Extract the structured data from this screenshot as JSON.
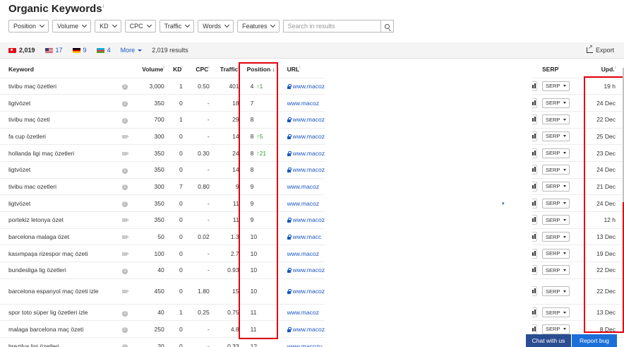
{
  "page": {
    "title": "Organic Keywords",
    "title_info": "i"
  },
  "filters": {
    "position": "Position",
    "volume": "Volume",
    "kd": "KD",
    "cpc": "CPC",
    "traffic": "Traffic",
    "words": "Words",
    "features": "Features",
    "search_placeholder": "Search in results"
  },
  "countries": {
    "tr_count": "2,019",
    "us_count": "17",
    "de_count": "9",
    "az_count": "4",
    "more": "More",
    "results": "2,019 results",
    "export": "Export"
  },
  "table": {
    "headers": {
      "keyword": "Keyword",
      "volume": "Volume",
      "kd": "KD",
      "cpc": "CPC",
      "traffic": "Traffic",
      "position": "Position",
      "position_sort": "↓",
      "url": "URL",
      "serp": "SERP",
      "upd": "Upd.",
      "info": "i"
    },
    "rows": [
      {
        "keyword": "tivibu maç özetleri",
        "icon": "question-icon",
        "icon_text": "2",
        "volume": "3,000",
        "kd": "1",
        "cpc": "0.50",
        "traffic": "401",
        "position": "4",
        "change": "↑1",
        "secure": true,
        "url": "www.macoz",
        "serp": "SERP",
        "upd": "19 h"
      },
      {
        "keyword": "ligtvözet",
        "icon": "question-icon",
        "icon_text": "2",
        "volume": "350",
        "kd": "0",
        "cpc": "-",
        "traffic": "18",
        "position": "7",
        "change": "",
        "secure": false,
        "url": "www.macoz",
        "serp": "SERP",
        "upd": "24 Dec"
      },
      {
        "keyword": "tivibu maç özeti",
        "icon": "question-icon",
        "icon_text": "2",
        "volume": "700",
        "kd": "1",
        "cpc": "-",
        "traffic": "29",
        "position": "8",
        "change": "",
        "secure": true,
        "url": "www.macoz",
        "serp": "SERP",
        "upd": "22 Dec"
      },
      {
        "keyword": "fa cup özetleri",
        "icon": "video-icon",
        "icon_text": "",
        "volume": "300",
        "kd": "0",
        "cpc": "-",
        "traffic": "14",
        "position": "8",
        "change": "↑5",
        "secure": true,
        "url": "www.macoz",
        "serp": "SERP",
        "upd": "25 Dec"
      },
      {
        "keyword": "hollanda ligi maç özetleri",
        "icon": "video-icon",
        "icon_text": "",
        "volume": "350",
        "kd": "0",
        "cpc": "0.30",
        "traffic": "24",
        "position": "8",
        "change": "↑21",
        "secure": true,
        "url": "www.macoz",
        "serp": "SERP",
        "upd": "23 Dec"
      },
      {
        "keyword": "ligtvözet",
        "icon": "question-icon",
        "icon_text": "2",
        "volume": "350",
        "kd": "0",
        "cpc": "-",
        "traffic": "14",
        "position": "8",
        "change": "",
        "secure": true,
        "url": "www.macoz",
        "serp": "SERP",
        "upd": "24 Dec"
      },
      {
        "keyword": "tivibu mac ozetleri",
        "icon": "question-icon",
        "icon_text": "2",
        "volume": "300",
        "kd": "7",
        "cpc": "0.80",
        "traffic": "9",
        "position": "9",
        "change": "",
        "secure": false,
        "url": "www.macoz",
        "serp": "SERP",
        "upd": "21 Dec"
      },
      {
        "keyword": "ligtvözet",
        "icon": "question-icon",
        "icon_text": "2",
        "volume": "350",
        "kd": "0",
        "cpc": "-",
        "traffic": "11",
        "position": "9",
        "change": "",
        "secure": false,
        "url": "www.macoz",
        "serp": "SERP",
        "upd": "24 Dec"
      },
      {
        "keyword": "portekiz letonya özet",
        "icon": "video-icon",
        "icon_text": "",
        "volume": "350",
        "kd": "0",
        "cpc": "-",
        "traffic": "11",
        "position": "9",
        "change": "",
        "secure": true,
        "url": "www.macoz",
        "serp": "SERP",
        "upd": "12 h"
      },
      {
        "keyword": "barcelona malaga özet",
        "icon": "video-icon",
        "icon_text": "",
        "volume": "50",
        "kd": "0",
        "cpc": "0.02",
        "traffic": "1.3",
        "position": "10",
        "change": "",
        "secure": true,
        "url": "www.macc",
        "serp": "SERP",
        "upd": "13 Dec"
      },
      {
        "keyword": "kasımpaşa rizespor maç özeti",
        "icon": "video-icon",
        "icon_text": "",
        "volume": "100",
        "kd": "0",
        "cpc": "-",
        "traffic": "2.7",
        "position": "10",
        "change": "",
        "secure": false,
        "url": "www.macoz",
        "serp": "SERP",
        "upd": "19 Dec"
      },
      {
        "keyword": "bundesliga lig özetleri",
        "icon": "question-icon",
        "icon_text": "3",
        "volume": "40",
        "kd": "0",
        "cpc": "-",
        "traffic": "0.93",
        "position": "10",
        "change": "",
        "secure": true,
        "url": "www.macoz",
        "serp": "SERP",
        "upd": "22 Dec"
      },
      {
        "keyword": "barcelona espanyol maç özeti izle",
        "icon": "video-icon",
        "icon_text": "",
        "volume": "450",
        "kd": "0",
        "cpc": "1.80",
        "traffic": "15",
        "position": "10",
        "change": "",
        "secure": true,
        "url": "www.macoz",
        "serp": "SERP",
        "upd": "22 Dec"
      },
      {
        "keyword": "spor toto süper lig özetleri izle",
        "icon": "question-icon",
        "icon_text": "3",
        "volume": "40",
        "kd": "1",
        "cpc": "0.25",
        "traffic": "0.75",
        "position": "11",
        "change": "",
        "secure": false,
        "url": "www.macoz",
        "serp": "SERP",
        "upd": "13 Dec"
      },
      {
        "keyword": "malaga barcelona maç özeti",
        "icon": "question-icon",
        "icon_text": "2",
        "volume": "250",
        "kd": "0",
        "cpc": "-",
        "traffic": "4.8",
        "position": "11",
        "change": "",
        "secure": true,
        "url": "www.macoz",
        "serp": "SERP",
        "upd": "8 Dec"
      },
      {
        "keyword": "brezilya ligi özetleri",
        "icon": "question-icon",
        "icon_text": "2",
        "volume": "20",
        "kd": "0",
        "cpc": "-",
        "traffic": "0.33",
        "position": "12",
        "change": "",
        "secure": false,
        "url": "www.macozu",
        "serp": "SERP",
        "upd": ""
      }
    ]
  },
  "footer": {
    "chat": "Chat with us",
    "bug": "Report bug"
  },
  "colors": {
    "accent": "#1a56c5",
    "highlight": "#e3000f",
    "up": "#2e9e2e",
    "chat_bg": "#2a4d91",
    "bug_bg": "#1c6fd9"
  }
}
